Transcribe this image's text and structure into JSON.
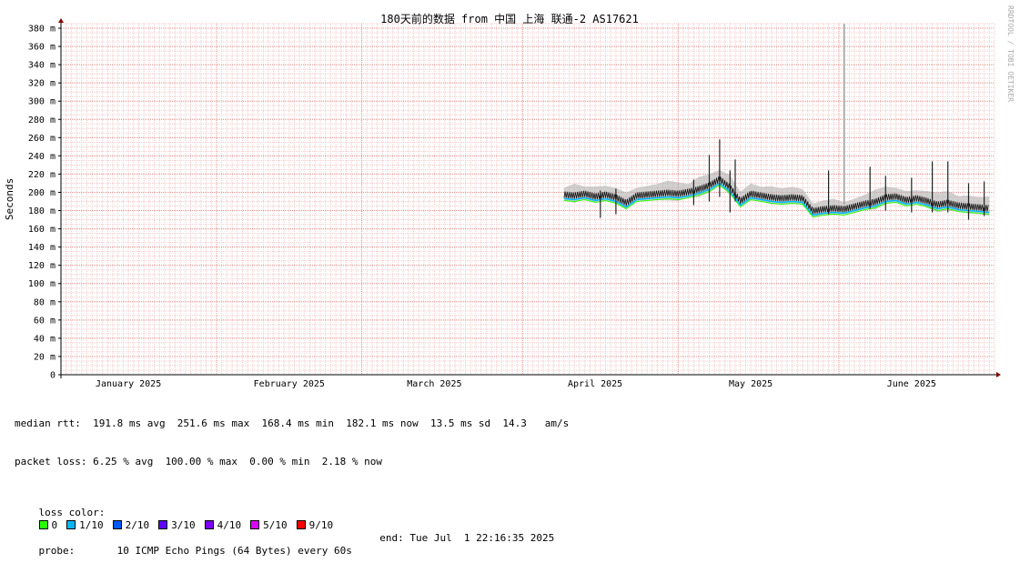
{
  "chart_data": {
    "type": "line",
    "title": "180天前的数据 from 中国 上海 联通-2 AS17621",
    "ylabel": "Seconds",
    "xlabel": "",
    "ylim": [
      0,
      385
    ],
    "yticks": [
      {
        "v": 0,
        "label": "0"
      },
      {
        "v": 20,
        "label": "20 m"
      },
      {
        "v": 40,
        "label": "40 m"
      },
      {
        "v": 60,
        "label": "60 m"
      },
      {
        "v": 80,
        "label": "80 m"
      },
      {
        "v": 100,
        "label": "100 m"
      },
      {
        "v": 120,
        "label": "120 m"
      },
      {
        "v": 140,
        "label": "140 m"
      },
      {
        "v": 160,
        "label": "160 m"
      },
      {
        "v": 180,
        "label": "180 m"
      },
      {
        "v": 200,
        "label": "200 m"
      },
      {
        "v": 220,
        "label": "220 m"
      },
      {
        "v": 240,
        "label": "240 m"
      },
      {
        "v": 260,
        "label": "260 m"
      },
      {
        "v": 280,
        "label": "280 m"
      },
      {
        "v": 300,
        "label": "300 m"
      },
      {
        "v": 320,
        "label": "320 m"
      },
      {
        "v": 340,
        "label": "340 m"
      },
      {
        "v": 360,
        "label": "360 m"
      },
      {
        "v": 380,
        "label": "380 m"
      }
    ],
    "x_start": "2025-01-02",
    "x_end": "2025-07-01",
    "month_labels": [
      {
        "label": "January 2025",
        "date": "2025-01-15"
      },
      {
        "label": "February 2025",
        "date": "2025-02-15"
      },
      {
        "label": "March 2025",
        "date": "2025-03-15"
      },
      {
        "label": "April 2025",
        "date": "2025-04-15"
      },
      {
        "label": "May 2025",
        "date": "2025-05-15"
      },
      {
        "label": "June 2025",
        "date": "2025-06-15"
      }
    ],
    "month_boundaries": [
      "2025-02-01",
      "2025-03-01",
      "2025-04-01",
      "2025-05-01",
      "2025-06-01"
    ],
    "grid": true,
    "outage_marker_date": "2025-06-02",
    "series": [
      {
        "name": "median rtt",
        "x": [
          "2025-04-09",
          "2025-04-11",
          "2025-04-13",
          "2025-04-15",
          "2025-04-17",
          "2025-04-19",
          "2025-04-21",
          "2025-04-23",
          "2025-04-25",
          "2025-04-27",
          "2025-04-29",
          "2025-05-01",
          "2025-05-03",
          "2025-05-05",
          "2025-05-07",
          "2025-05-09",
          "2025-05-11",
          "2025-05-13",
          "2025-05-15",
          "2025-05-17",
          "2025-05-19",
          "2025-05-21",
          "2025-05-23",
          "2025-05-25",
          "2025-05-27",
          "2025-05-29",
          "2025-05-31",
          "2025-06-02",
          "2025-06-04",
          "2025-06-06",
          "2025-06-08",
          "2025-06-10",
          "2025-06-12",
          "2025-06-14",
          "2025-06-16",
          "2025-06-18",
          "2025-06-20",
          "2025-06-22",
          "2025-06-24",
          "2025-06-26",
          "2025-06-28",
          "2025-06-30"
        ],
        "values": [
          197,
          196,
          198,
          195,
          197,
          194,
          188,
          196,
          197,
          198,
          199,
          198,
          200,
          203,
          207,
          214,
          205,
          190,
          198,
          196,
          194,
          193,
          194,
          193,
          179,
          181,
          182,
          181,
          184,
          187,
          189,
          194,
          195,
          191,
          193,
          190,
          186,
          188,
          185,
          184,
          183,
          182
        ]
      }
    ],
    "spikes": [
      {
        "x": "2025-04-16",
        "hi": 202,
        "lo": 172
      },
      {
        "x": "2025-04-19",
        "hi": 204,
        "lo": 176
      },
      {
        "x": "2025-05-04",
        "hi": 214,
        "lo": 186
      },
      {
        "x": "2025-05-07",
        "hi": 241,
        "lo": 190
      },
      {
        "x": "2025-05-09",
        "hi": 258,
        "lo": 195
      },
      {
        "x": "2025-05-11",
        "hi": 224,
        "lo": 178
      },
      {
        "x": "2025-05-12",
        "hi": 236,
        "lo": 190
      },
      {
        "x": "2025-05-30",
        "hi": 224,
        "lo": 176
      },
      {
        "x": "2025-06-07",
        "hi": 228,
        "lo": 182
      },
      {
        "x": "2025-06-10",
        "hi": 218,
        "lo": 180
      },
      {
        "x": "2025-06-15",
        "hi": 216,
        "lo": 178
      },
      {
        "x": "2025-06-19",
        "hi": 234,
        "lo": 178
      },
      {
        "x": "2025-06-22",
        "hi": 234,
        "lo": 178
      },
      {
        "x": "2025-06-26",
        "hi": 210,
        "lo": 170
      },
      {
        "x": "2025-06-29",
        "hi": 212,
        "lo": 174
      }
    ]
  },
  "watermark": "RRDTOOL / TOBI OETIKER",
  "stats": {
    "rtt_line": "median rtt:  191.8 ms avg  251.6 ms max  168.4 ms min  182.1 ms now  13.5 ms sd  14.3   am/s",
    "loss_line": "packet loss: 6.25 % avg  100.00 % max  0.00 % min  2.18 % now",
    "loss_color_label": "loss color:",
    "loss_colors": [
      {
        "label": "0",
        "color": "#26ff00"
      },
      {
        "label": "1/10",
        "color": "#00b8ff"
      },
      {
        "label": "2/10",
        "color": "#0059ff"
      },
      {
        "label": "3/10",
        "color": "#5e00ff"
      },
      {
        "label": "4/10",
        "color": "#7e00ff"
      },
      {
        "label": "5/10",
        "color": "#dd00ff"
      },
      {
        "label": "9/10",
        "color": "#ff0000"
      }
    ],
    "probe_line": "probe:       10 ICMP Echo Pings (64 Bytes) every 60s",
    "end_line": "end: Tue Jul  1 22:16:35 2025"
  },
  "colors": {
    "grid_minor": "#f2c8c8",
    "grid_major": "#e58f8f",
    "axis": "#000000",
    "arrow": "#800000",
    "smoke": "#b0b0b0",
    "spike": "#222222"
  }
}
